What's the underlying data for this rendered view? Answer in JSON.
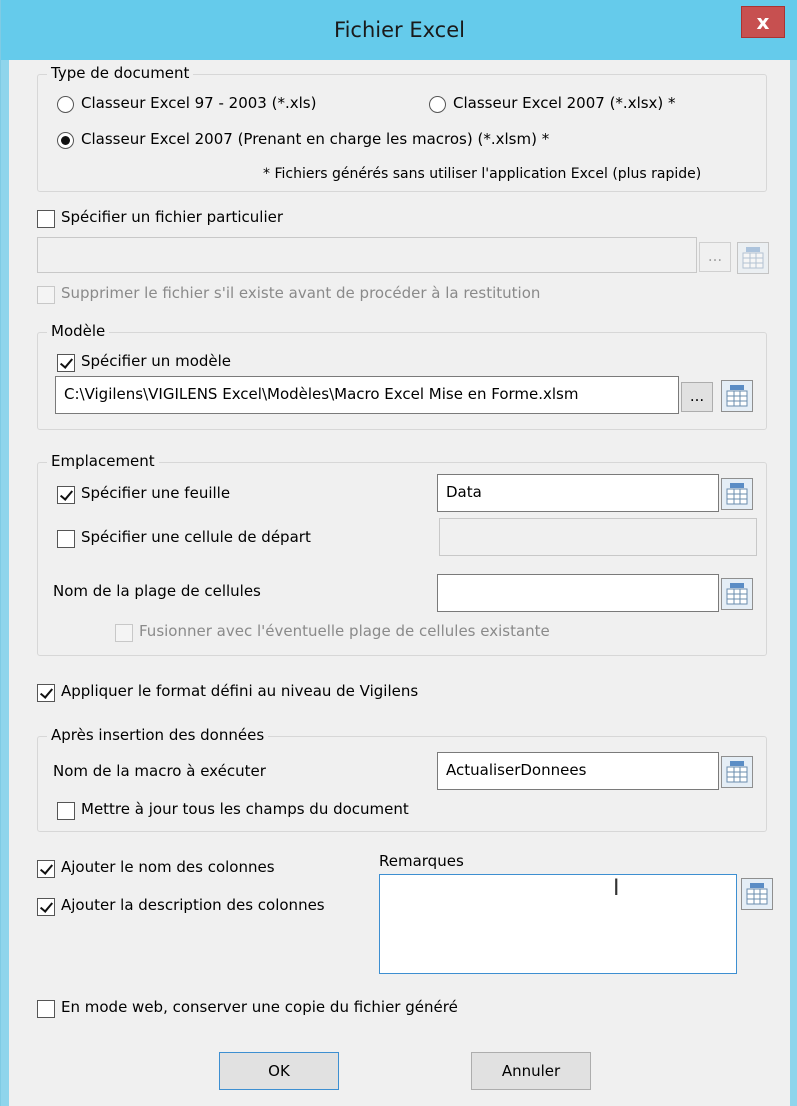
{
  "window": {
    "title": "Fichier Excel",
    "close_label": "x"
  },
  "type_document": {
    "legend": "Type de document",
    "options": [
      {
        "label": "Classeur Excel 97 - 2003 (*.xls)",
        "checked": false
      },
      {
        "label": "Classeur Excel 2007 (*.xlsx) *",
        "checked": false
      },
      {
        "label": "Classeur Excel 2007 (Prenant en charge les macros) (*.xlsm) *",
        "checked": true
      }
    ],
    "note": "* Fichiers générés sans utiliser l'application Excel (plus rapide)"
  },
  "fichier": {
    "specify_label": "Spécifier un fichier particulier",
    "path_value": "",
    "browse_label": "...",
    "delete_label": "Supprimer le fichier s'il existe avant de procéder à la restitution"
  },
  "modele": {
    "legend": "Modèle",
    "specify_label": "Spécifier un modèle",
    "path_value": "C:\\Vigilens\\VIGILENS Excel\\Modèles\\Macro Excel Mise en Forme.xlsm",
    "browse_label": "..."
  },
  "emplacement": {
    "legend": "Emplacement",
    "sheet_label": "Spécifier une feuille",
    "sheet_value": "Data",
    "cell_label": "Spécifier une cellule de départ",
    "cell_value": "",
    "range_label": "Nom de la plage de cellules",
    "range_value": "",
    "merge_label": "Fusionner avec l'éventuelle plage de cellules existante"
  },
  "format_label": "Appliquer le format défini au niveau de Vigilens",
  "apres": {
    "legend": "Après insertion des données",
    "macro_label": "Nom de la macro à exécuter",
    "macro_value": "ActualiserDonnees",
    "update_label": "Mettre à jour tous les champs du document"
  },
  "colonnes": {
    "names_label": "Ajouter le nom des colonnes",
    "desc_label": "Ajouter la description des colonnes"
  },
  "remarques": {
    "label": "Remarques",
    "value": ""
  },
  "web_copy_label": "En mode web, conserver une copie du fichier généré",
  "buttons": {
    "ok": "OK",
    "cancel": "Annuler"
  },
  "colors": {
    "titlebar": "#65cbeb",
    "close": "#c75050",
    "focus_border": "#3d8fd1"
  }
}
